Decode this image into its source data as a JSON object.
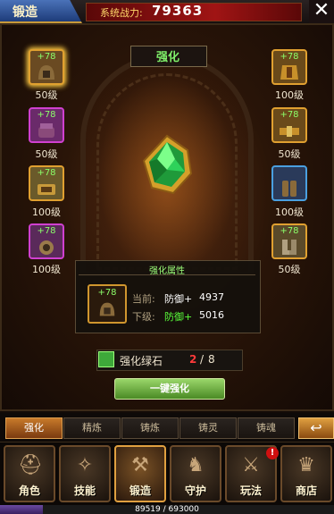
{
  "header": {
    "title": "锻造",
    "power_label": "系统战力:",
    "power_value": "79363",
    "close": "✕"
  },
  "panel": {
    "banner": "强化"
  },
  "left_slots": [
    {
      "plus": "+78",
      "level": "50级",
      "border": "#e0a030",
      "bg": "#6a4a22",
      "active": true
    },
    {
      "plus": "+78",
      "level": "50级",
      "border": "#d040d0",
      "bg": "#6a2a6a",
      "active": false
    },
    {
      "plus": "+78",
      "level": "100级",
      "border": "#e0a030",
      "bg": "#6a5a2a",
      "active": false
    },
    {
      "plus": "+78",
      "level": "100级",
      "border": "#d040d0",
      "bg": "#5a2a5a",
      "active": false
    }
  ],
  "right_slots": [
    {
      "plus": "+78",
      "level": "100级",
      "border": "#e0a030",
      "bg": "#6a4a1a"
    },
    {
      "plus": "+78",
      "level": "50级",
      "border": "#e0a030",
      "bg": "#6a4a1a"
    },
    {
      "plus": "",
      "level": "100级",
      "border": "#4aa0e0",
      "bg": "#2a3a5a"
    },
    {
      "plus": "+78",
      "level": "50级",
      "border": "#e0a030",
      "bg": "#5a4a2a"
    }
  ],
  "attributes": {
    "title": "强化属性",
    "slot_plus": "+78",
    "current_label": "当前:",
    "current_stat": "防御+",
    "current_value": "4937",
    "next_label": "下级:",
    "next_stat": "防御+",
    "next_value": "5016"
  },
  "material": {
    "name": "强化绿石",
    "have": "2",
    "sep": "/",
    "need": "8"
  },
  "upgrade_button": "一键强化",
  "tabs": [
    {
      "label": "强化",
      "active": true
    },
    {
      "label": "精炼",
      "active": false
    },
    {
      "label": "铸炼",
      "active": false
    },
    {
      "label": "铸灵",
      "active": false
    },
    {
      "label": "铸魂",
      "active": false
    }
  ],
  "back_icon": "↩",
  "nav": [
    {
      "label": "角色",
      "icon": "helmet-icon",
      "active": false
    },
    {
      "label": "技能",
      "icon": "scroll-icon",
      "active": false
    },
    {
      "label": "锻造",
      "icon": "anvil-icon",
      "active": true
    },
    {
      "label": "守护",
      "icon": "dragon-icon",
      "active": false
    },
    {
      "label": "玩法",
      "icon": "swords-icon",
      "active": false,
      "badge": "!"
    },
    {
      "label": "商店",
      "icon": "treasure-icon",
      "active": false
    }
  ],
  "exp": {
    "text": "89519 / 693000",
    "fraction": 0.129
  }
}
